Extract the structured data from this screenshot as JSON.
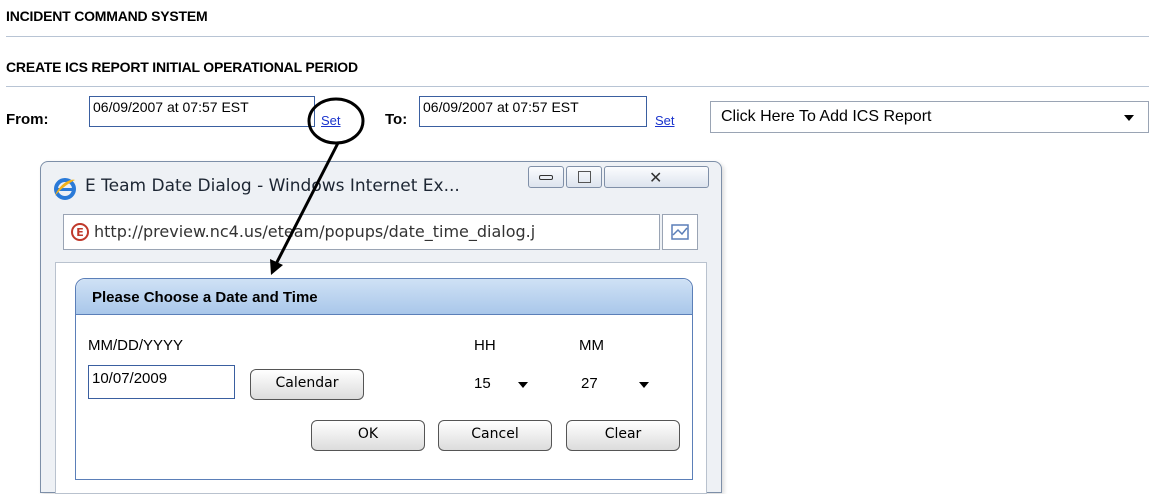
{
  "header": {
    "title": "INCIDENT COMMAND SYSTEM",
    "subtitle": "CREATE ICS REPORT INITIAL OPERATIONAL PERIOD"
  },
  "period": {
    "from_label": "From:",
    "from_value": "06/09/2007 at 07:57 EST",
    "from_set": "Set",
    "to_label": "To:",
    "to_value": "06/09/2007 at 07:57 EST",
    "to_set": "Set",
    "report_select": "Click Here To Add ICS Report"
  },
  "popup": {
    "window_title": "E Team Date Dialog - Windows Internet Ex...",
    "url": "http://preview.nc4.us/eteam/popups/date_time_dialog.j",
    "panel_title": "Please Choose a Date and Time",
    "date_label": "MM/DD/YYYY",
    "date_value": "10/07/2009",
    "calendar_button": "Calendar",
    "hh_label": "HH",
    "hh_value": "15",
    "mm_label": "MM",
    "mm_value": "27",
    "ok_button": "OK",
    "cancel_button": "Cancel",
    "clear_button": "Clear"
  },
  "colors": {
    "link": "#1a33cc",
    "panel_header": "#a9c7ea",
    "rule": "#b8c4d4"
  }
}
